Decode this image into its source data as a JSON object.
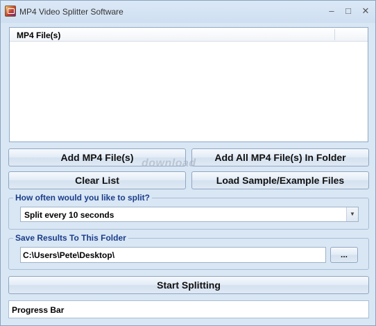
{
  "window": {
    "title": "MP4 Video Splitter Software",
    "icon": "app-video-icon"
  },
  "titlebar_buttons": {
    "minimize": "–",
    "maximize": "□",
    "close": "✕"
  },
  "file_list": {
    "columns": [
      "MP4 File(s)"
    ],
    "rows": []
  },
  "buttons": {
    "add_files": "Add MP4 File(s)",
    "add_folder": "Add All MP4 File(s) In Folder",
    "clear_list": "Clear List",
    "load_samples": "Load Sample/Example Files",
    "start_splitting": "Start Splitting",
    "browse": "..."
  },
  "split_group": {
    "legend": "How often would you like to split?",
    "selected": "Split every 10 seconds",
    "arrow": "▼"
  },
  "save_group": {
    "legend": "Save Results To This Folder",
    "path": "C:\\Users\\Pete\\Desktop\\"
  },
  "progress": {
    "label": "Progress Bar",
    "value": 0
  },
  "watermark": "download",
  "colors": {
    "accent_legend": "#1a3d8a",
    "window_bg": "#d9e6f4"
  }
}
